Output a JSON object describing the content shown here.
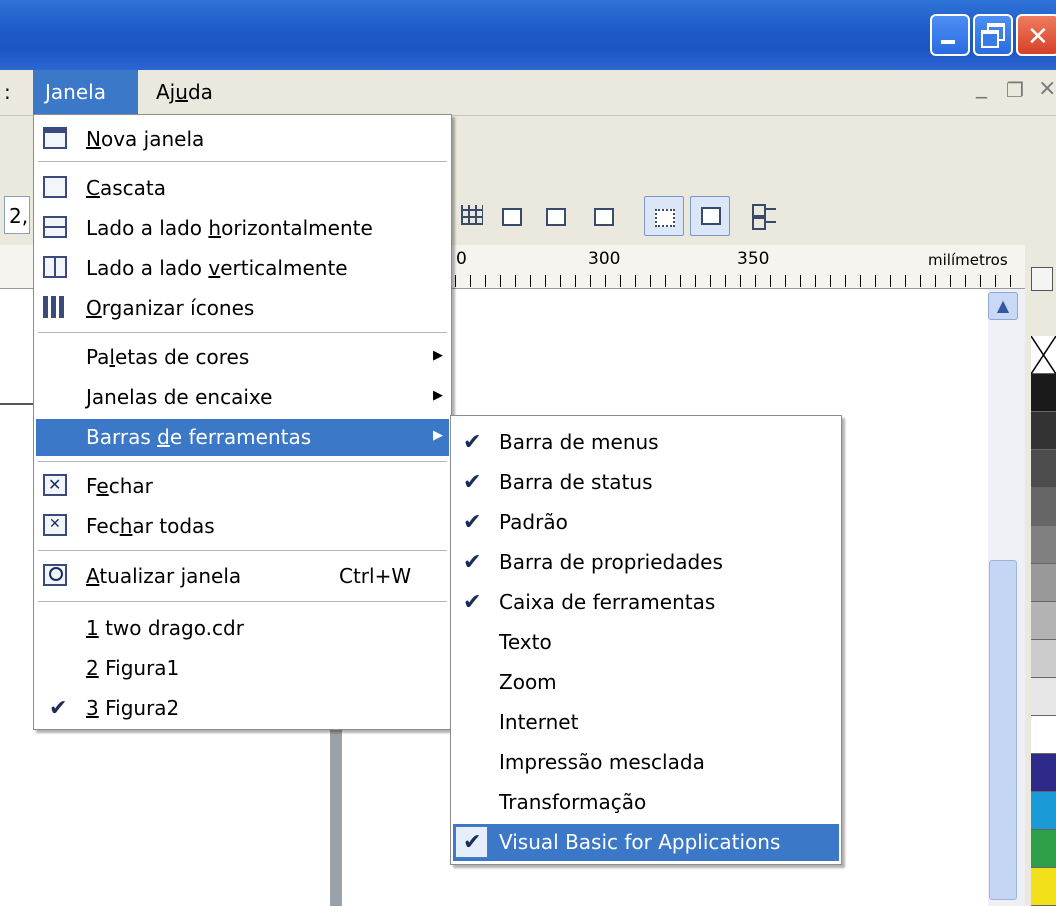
{
  "menubar": {
    "left_cut": ":",
    "janela": {
      "pre": "",
      "ul": "J",
      "post": "anela"
    },
    "ajuda": {
      "pre": "Aj",
      "ul": "u",
      "post": "da"
    },
    "mdi_minimize": "_",
    "mdi_restore": "❐",
    "mdi_close": "×"
  },
  "toolbar": {
    "input_value": "2,"
  },
  "ruler": {
    "ticks": [
      "0",
      "300",
      "350"
    ],
    "unit": "milímetros"
  },
  "janela_menu": {
    "nova_janela": {
      "pre": "",
      "ul": "N",
      "post": "ova janela"
    },
    "cascata": {
      "pre": "",
      "ul": "C",
      "post": "ascata"
    },
    "lado_h": {
      "pre": "Lado a lado ",
      "ul": "h",
      "post": "orizontalmente"
    },
    "lado_v": {
      "pre": "Lado a lado ",
      "ul": "v",
      "post": "erticalmente"
    },
    "organizar": {
      "pre": "",
      "ul": "O",
      "post": "rganizar ícones"
    },
    "paletas": {
      "pre": "Pa",
      "ul": "l",
      "post": "etas de cores"
    },
    "janelas_encaixe": {
      "pre": "",
      "ul": "J",
      "post": "anelas de encaixe"
    },
    "barras": {
      "pre": "Barras ",
      "ul": "d",
      "post": "e ferramentas"
    },
    "fechar": {
      "pre": "F",
      "ul": "e",
      "post": "char"
    },
    "fechar_todas": {
      "pre": "Fec",
      "ul": "h",
      "post": "ar todas"
    },
    "atualizar": {
      "pre": "",
      "ul": "A",
      "post": "tualizar janela"
    },
    "atualizar_shortcut": "Ctrl+W",
    "doc1": {
      "pre": "",
      "ul": "1",
      "post": " two drago.cdr"
    },
    "doc2": {
      "pre": "",
      "ul": "2",
      "post": " Figura1"
    },
    "doc3": {
      "pre": "",
      "ul": "3",
      "post": " Figura2"
    }
  },
  "toolbars_submenu": [
    {
      "label": "Barra de menus",
      "checked": true
    },
    {
      "label": "Barra de status",
      "checked": true
    },
    {
      "label": "Padrão",
      "checked": true
    },
    {
      "label": "Barra de propriedades",
      "checked": true
    },
    {
      "label": "Caixa de ferramentas",
      "checked": true
    },
    {
      "label": "Texto",
      "checked": false
    },
    {
      "label": "Zoom",
      "checked": false
    },
    {
      "label": "Internet",
      "checked": false
    },
    {
      "label": "Impressão mesclada",
      "checked": false
    },
    {
      "label": "Transformação",
      "checked": false
    },
    {
      "label": "Visual Basic for Applications",
      "checked": true
    }
  ],
  "glyphs": {
    "check": "✔",
    "arrow": "▶",
    "scroll_up": "▲"
  },
  "icons": [
    "nova-janela-icon",
    "cascata-icon",
    "tile-horizontal-icon",
    "tile-vertical-icon",
    "arrange-icons-icon",
    "close-window-icon",
    "close-all-icon",
    "refresh-window-icon"
  ],
  "colors": {
    "titlebar": "#2060d0",
    "highlight": "#3c78c8",
    "palette": [
      "#ffffff",
      "#1a1a1a",
      "#333333",
      "#4d4d4d",
      "#666666",
      "#808080",
      "#999999",
      "#b3b3b3",
      "#cccccc",
      "#e6e6e6",
      "#ffffff",
      "#2e2a8a",
      "#1a9ad6",
      "#2ea04a",
      "#f2e01a"
    ]
  }
}
